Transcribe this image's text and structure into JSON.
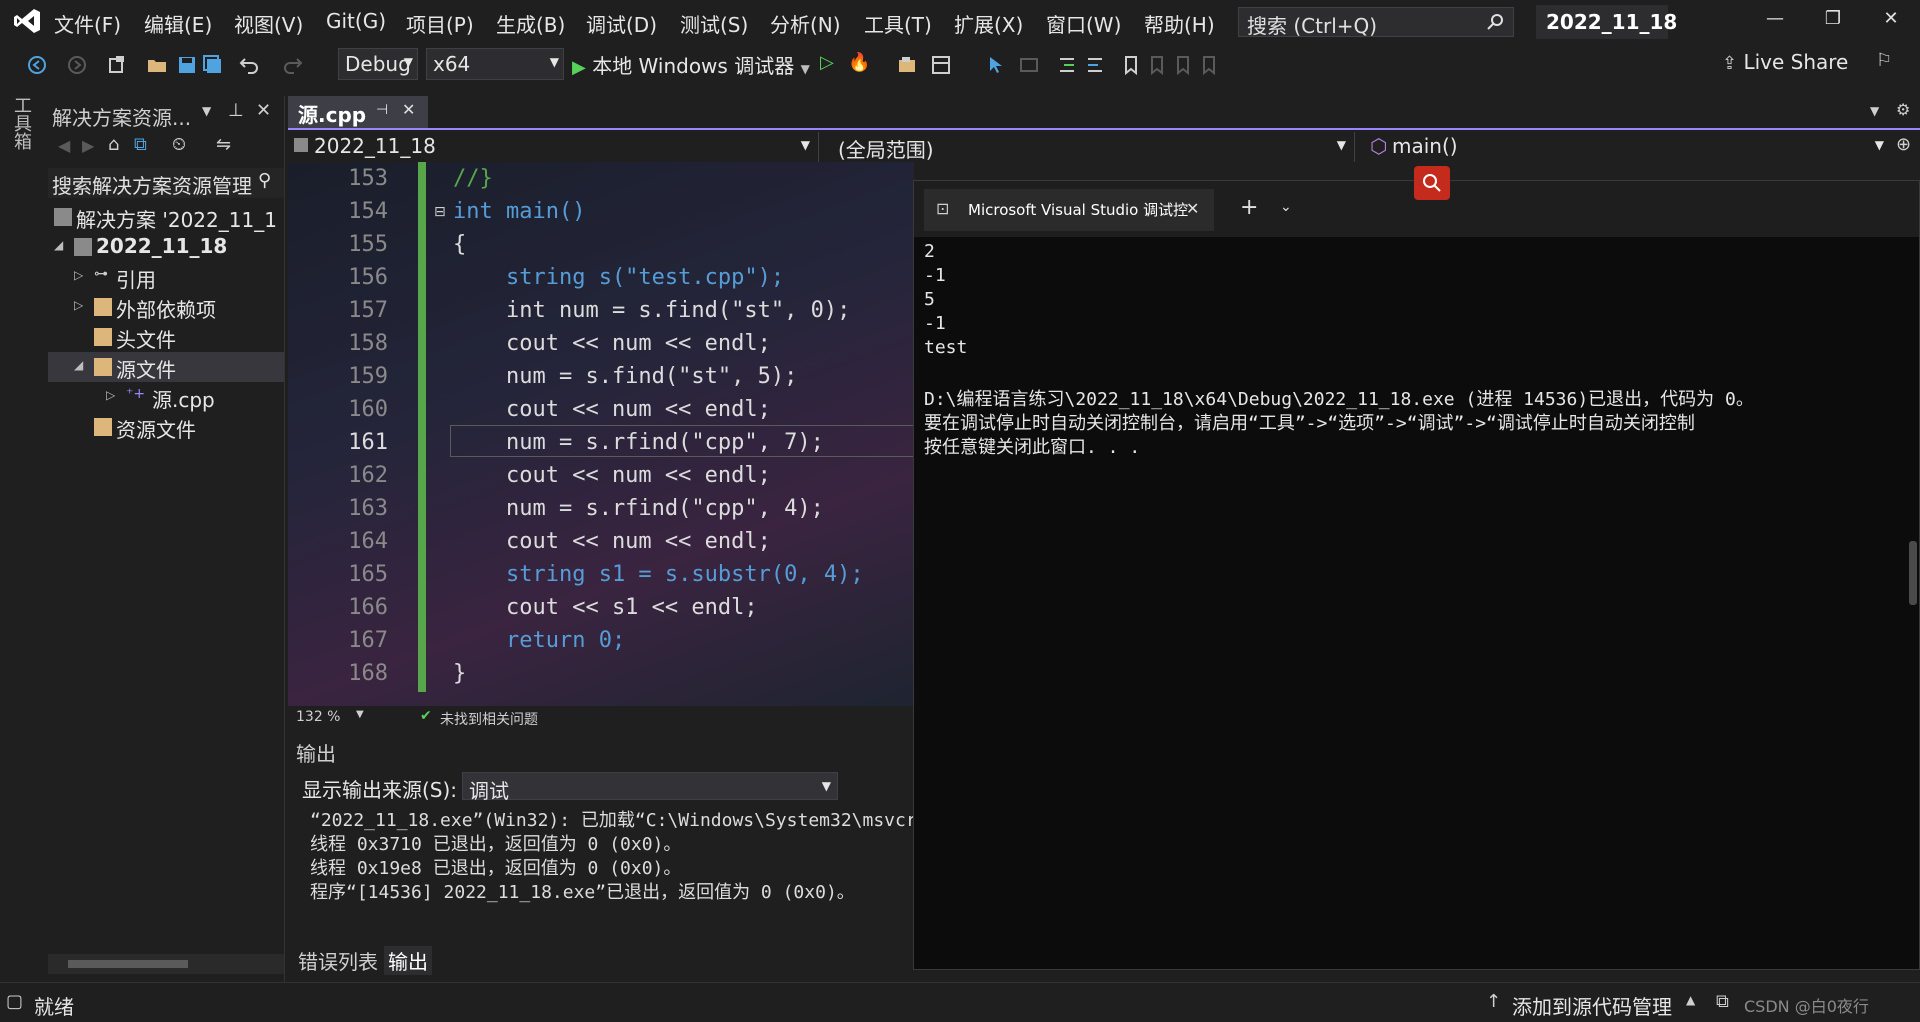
{
  "menu": [
    "文件(F)",
    "编辑(E)",
    "视图(V)",
    "Git(G)",
    "项目(P)",
    "生成(B)",
    "调试(D)",
    "测试(S)",
    "分析(N)",
    "工具(T)",
    "扩展(X)",
    "窗口(W)",
    "帮助(H)"
  ],
  "search": {
    "placeholder": "搜索 (Ctrl+Q)"
  },
  "solution_name": "2022_11_18",
  "toolbar": {
    "config": "Debug",
    "platform": "x64",
    "run_label": "本地 Windows 调试器",
    "live_share": "Live Share"
  },
  "toolbox_label": "工具箱",
  "solution_explorer": {
    "title": "解决方案资源...",
    "search": "搜索解决方案资源管理器",
    "tree": [
      {
        "label": "解决方案 '2022_11_1"
      },
      {
        "label": "2022_11_18"
      },
      {
        "label": "引用"
      },
      {
        "label": "外部依赖项"
      },
      {
        "label": "头文件"
      },
      {
        "label": "源文件"
      },
      {
        "label": "源.cpp"
      },
      {
        "label": "资源文件"
      }
    ]
  },
  "editor": {
    "tab": "源.cpp",
    "nav": {
      "project": "2022_11_18",
      "scope": "(全局范围)",
      "member": "main()"
    },
    "zoom": "132 %",
    "issues": "未找到相关问题"
  },
  "code_lines": [
    {
      "n": "153",
      "text": "//}"
    },
    {
      "n": "154",
      "text": "int main()"
    },
    {
      "n": "155",
      "text": "{"
    },
    {
      "n": "156",
      "text": "    string s(\"test.cpp\");"
    },
    {
      "n": "157",
      "text": "    int num = s.find(\"st\", 0);"
    },
    {
      "n": "158",
      "text": "    cout << num << endl;"
    },
    {
      "n": "159",
      "text": "    num = s.find(\"st\", 5);"
    },
    {
      "n": "160",
      "text": "    cout << num << endl;"
    },
    {
      "n": "161",
      "text": "    num = s.rfind(\"cpp\", 7);"
    },
    {
      "n": "162",
      "text": "    cout << num << endl;"
    },
    {
      "n": "163",
      "text": "    num = s.rfind(\"cpp\", 4);"
    },
    {
      "n": "164",
      "text": "    cout << num << endl;"
    },
    {
      "n": "165",
      "text": "    string s1 = s.substr(0, 4);"
    },
    {
      "n": "166",
      "text": "    cout << s1 << endl;"
    },
    {
      "n": "167",
      "text": "    return 0;"
    },
    {
      "n": "168",
      "text": "}"
    }
  ],
  "output": {
    "title": "输出",
    "source_label": "显示输出来源(S):",
    "source_value": "调试",
    "lines": [
      "“2022_11_18.exe”(Win32): 已加载“C:\\Windows\\System32\\msvcrt",
      "线程 0x3710 已退出，返回值为 0 (0x0)。",
      "线程 0x19e8 已退出，返回值为 0 (0x0)。",
      "程序“[14536] 2022_11_18.exe”已退出，返回值为 0 (0x0)。"
    ],
    "tabs": [
      "错误列表",
      "输出"
    ]
  },
  "console": {
    "tab_title": "Microsoft Visual Studio 调试控",
    "lines": [
      "2",
      "-1",
      "5",
      "-1",
      "test",
      "",
      "D:\\编程语言练习\\2022_11_18\\x64\\Debug\\2022_11_18.exe (进程 14536)已退出，代码为 0。",
      "要在调试停止时自动关闭控制台，请启用“工具”->“选项”->“调试”->“调试停止时自动关闭控制",
      "按任意键关闭此窗口. . ."
    ]
  },
  "status": {
    "text": "就绪",
    "source_control": "添加到源代码管理",
    "watermark": "CSDN @白0夜行"
  }
}
